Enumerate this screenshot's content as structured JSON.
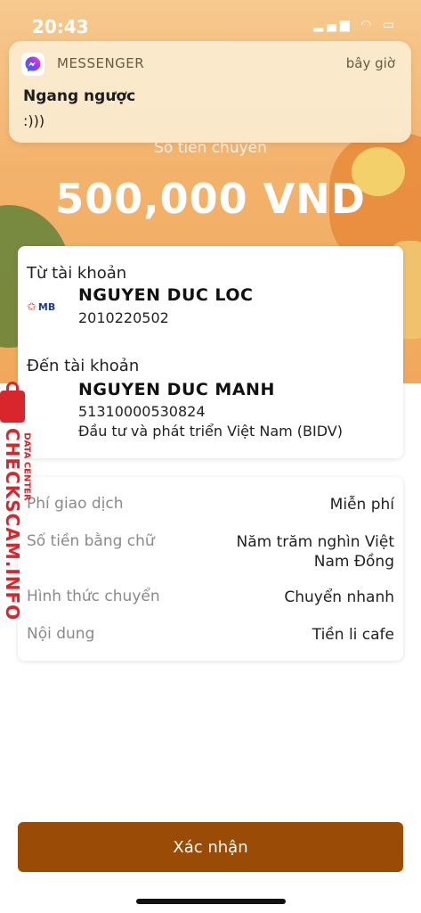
{
  "status_bar": {
    "time": "20:43",
    "icons": "▂▄▆ ◠ ▭"
  },
  "notification": {
    "app": "MESSENGER",
    "time": "bây giờ",
    "title": "Ngang ngược",
    "body": ":)))"
  },
  "transfer": {
    "amount_label": "Số tiền chuyển",
    "amount": "500,000 VND"
  },
  "from": {
    "label": "Từ tài khoản",
    "bank_logo": "MB",
    "name": "NGUYEN DUC LOC",
    "account": "2010220502"
  },
  "to": {
    "label": "Đến tài khoản",
    "name": "NGUYEN DUC MANH",
    "account": "51310000530824",
    "bank": "Đầu tư và phát triển Việt Nam (BIDV)"
  },
  "details": [
    {
      "key": "Phí giao dịch",
      "value": "Miễn phí"
    },
    {
      "key": "Số tiền bằng chữ",
      "value": "Năm trăm nghìn Việt Nam Đồng"
    },
    {
      "key": "Hình thức chuyển",
      "value": "Chuyển nhanh"
    },
    {
      "key": "Nội dung",
      "value": "Tiền li cafe"
    }
  ],
  "confirm_label": "Xác nhận",
  "watermark": {
    "text": "CHECKSCAM.INFO",
    "sub": "DATA CENTER"
  },
  "colors": {
    "primary": "#9a4c06",
    "hero": "#f3b26b",
    "watermark": "#d9262c"
  }
}
